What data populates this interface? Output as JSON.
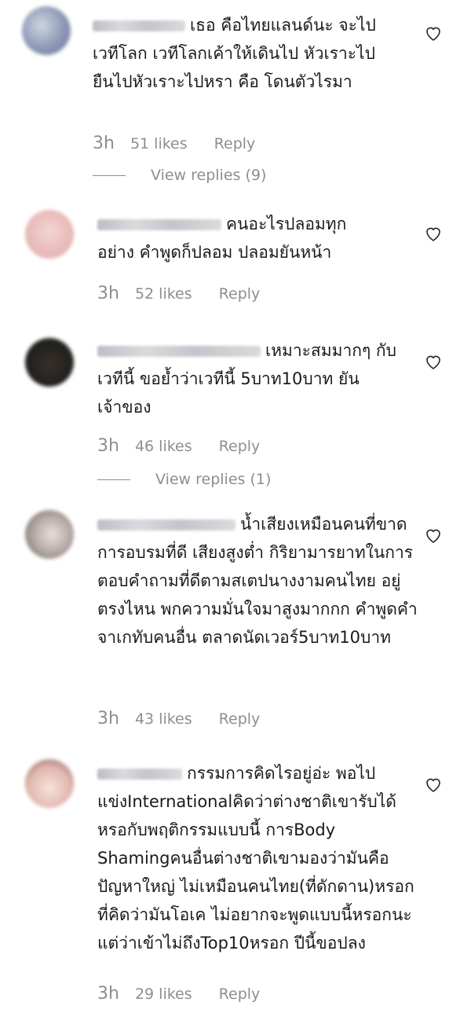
{
  "comments": [
    {
      "text": "เธอ คือไทยแลนด์นะ จะไปเวทีโลก เวทีโลกเค้าให้เดินไป หัวเราะไป ยืนไปหัวเราะไปหรา คือ โดนตัวไรมา",
      "time": "3h",
      "likes": "51 likes",
      "reply": "Reply",
      "view_replies": "View replies (9)"
    },
    {
      "text": "คนอะไรปลอมทุกอย่าง คำพูดก็ปลอม ปลอมยันหน้า",
      "time": "3h",
      "likes": "52 likes",
      "reply": "Reply"
    },
    {
      "text": "เหมาะสมมากๆ กับเวทีนี้ ขอย้ำว่าเวทีนี้ 5บาท10บาท ยันเจ้าของ",
      "time": "3h",
      "likes": "46 likes",
      "reply": "Reply",
      "view_replies": "View replies (1)"
    },
    {
      "text": "น้ำเสียงเหมือนคนที่ขาดการอบรมที่ดี เสียงสูงต่ำ กิริยามารยาทในการตอบคำถามที่ดีตามสเตปนางงามคนไทย อยู่ตรงไหน พกความมั่นใจมาสูงมากกก คำพูดคำจาเกทับคนอื่น ตลาดนัดเวอร์5บาท10บาท",
      "time": "3h",
      "likes": "43 likes",
      "reply": "Reply"
    },
    {
      "text": "กรรมการคิดไรอยู่อ่ะ พอไปแข่งInternationalคิดว่าต่างชาติเขารับได้หรอกับพฤติกรรมแบบนี้ การBody Shamingคนอื่นต่างชาติเขามองว่ามันคือปัญหาใหญ่ ไม่เหมือนคนไทย(ที่ดักดาน)หรอกที่คิดว่ามันโอเค ไม่อยากจะพูดแบบนี้หรอกนะแต่ว่าเข้าไม่ถึงTop10หรอก ปีนี้ขอปลง",
      "time": "3h",
      "likes": "29 likes",
      "reply": "Reply"
    }
  ],
  "colors": {
    "text": "#1a1a1a",
    "muted": "#8e8e8e"
  }
}
